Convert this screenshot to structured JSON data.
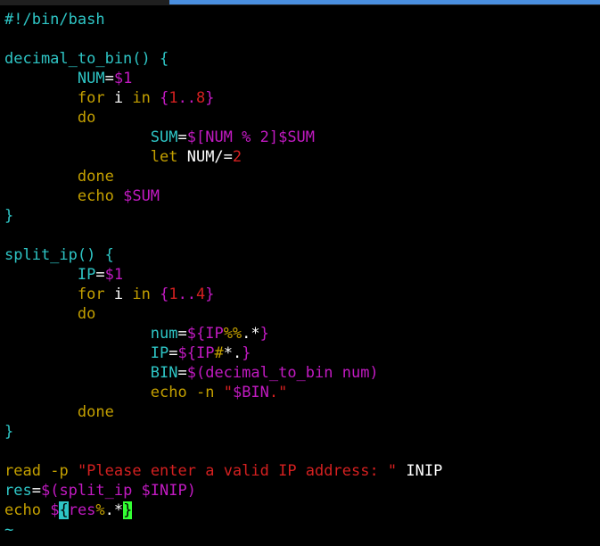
{
  "colors": {
    "background": "#000000",
    "default": "#ffffff",
    "cyan": "#2ec5c5",
    "yellow": "#c4a000",
    "magenta": "#c21ac2",
    "red": "#d42020",
    "green": "#33ff33",
    "cursor": "#2ec5c5"
  },
  "lines": [
    [
      {
        "t": "#!/bin/bash",
        "c": "cyan"
      }
    ],
    [],
    [
      {
        "t": "decimal_to_bin() {",
        "c": "cyan"
      }
    ],
    [
      {
        "t": "        "
      },
      {
        "t": "NUM",
        "c": "cyan"
      },
      {
        "t": "="
      },
      {
        "t": "$1",
        "c": "magenta"
      }
    ],
    [
      {
        "t": "        "
      },
      {
        "t": "for",
        "c": "yellow"
      },
      {
        "t": " i "
      },
      {
        "t": "in",
        "c": "yellow"
      },
      {
        "t": " "
      },
      {
        "t": "{",
        "c": "magenta"
      },
      {
        "t": "1",
        "c": "red"
      },
      {
        "t": "..",
        "c": "magenta"
      },
      {
        "t": "8",
        "c": "red"
      },
      {
        "t": "}",
        "c": "magenta"
      }
    ],
    [
      {
        "t": "        "
      },
      {
        "t": "do",
        "c": "yellow"
      }
    ],
    [
      {
        "t": "                "
      },
      {
        "t": "SUM",
        "c": "cyan"
      },
      {
        "t": "="
      },
      {
        "t": "$[NUM % 2]$SUM",
        "c": "magenta"
      }
    ],
    [
      {
        "t": "                "
      },
      {
        "t": "let",
        "c": "yellow"
      },
      {
        "t": " NUM/="
      },
      {
        "t": "2",
        "c": "red"
      }
    ],
    [
      {
        "t": "        "
      },
      {
        "t": "done",
        "c": "yellow"
      }
    ],
    [
      {
        "t": "        "
      },
      {
        "t": "echo",
        "c": "yellow"
      },
      {
        "t": " "
      },
      {
        "t": "$SUM",
        "c": "magenta"
      }
    ],
    [
      {
        "t": "}",
        "c": "cyan"
      }
    ],
    [],
    [
      {
        "t": "split_ip() {",
        "c": "cyan"
      }
    ],
    [
      {
        "t": "        "
      },
      {
        "t": "IP",
        "c": "cyan"
      },
      {
        "t": "="
      },
      {
        "t": "$1",
        "c": "magenta"
      }
    ],
    [
      {
        "t": "        "
      },
      {
        "t": "for",
        "c": "yellow"
      },
      {
        "t": " i "
      },
      {
        "t": "in",
        "c": "yellow"
      },
      {
        "t": " "
      },
      {
        "t": "{",
        "c": "magenta"
      },
      {
        "t": "1",
        "c": "red"
      },
      {
        "t": "..",
        "c": "magenta"
      },
      {
        "t": "4",
        "c": "red"
      },
      {
        "t": "}",
        "c": "magenta"
      }
    ],
    [
      {
        "t": "        "
      },
      {
        "t": "do",
        "c": "yellow"
      }
    ],
    [
      {
        "t": "                "
      },
      {
        "t": "num",
        "c": "cyan"
      },
      {
        "t": "="
      },
      {
        "t": "${IP",
        "c": "magenta"
      },
      {
        "t": "%%",
        "c": "yellow"
      },
      {
        "t": ".*"
      },
      {
        "t": "}",
        "c": "magenta"
      }
    ],
    [
      {
        "t": "                "
      },
      {
        "t": "IP",
        "c": "cyan"
      },
      {
        "t": "="
      },
      {
        "t": "${IP",
        "c": "magenta"
      },
      {
        "t": "#",
        "c": "yellow"
      },
      {
        "t": "*."
      },
      {
        "t": "}",
        "c": "magenta"
      }
    ],
    [
      {
        "t": "                "
      },
      {
        "t": "BIN",
        "c": "cyan"
      },
      {
        "t": "="
      },
      {
        "t": "$(decimal_to_bin num)",
        "c": "magenta"
      }
    ],
    [
      {
        "t": "                "
      },
      {
        "t": "echo",
        "c": "yellow"
      },
      {
        "t": " "
      },
      {
        "t": "-n",
        "c": "yellow"
      },
      {
        "t": " "
      },
      {
        "t": "\"",
        "c": "red"
      },
      {
        "t": "$BIN",
        "c": "magenta"
      },
      {
        "t": ".\"",
        "c": "red"
      }
    ],
    [
      {
        "t": "        "
      },
      {
        "t": "done",
        "c": "yellow"
      }
    ],
    [
      {
        "t": "}",
        "c": "cyan"
      }
    ],
    [],
    [
      {
        "t": "read",
        "c": "yellow"
      },
      {
        "t": " "
      },
      {
        "t": "-p",
        "c": "yellow"
      },
      {
        "t": " "
      },
      {
        "t": "\"Please enter a valid IP address: \"",
        "c": "red"
      },
      {
        "t": " INIP"
      }
    ],
    [
      {
        "t": "res",
        "c": "cyan"
      },
      {
        "t": "="
      },
      {
        "t": "$(split_ip $INIP)",
        "c": "magenta"
      }
    ],
    [
      {
        "t": "echo",
        "c": "yellow"
      },
      {
        "t": " "
      },
      {
        "t": "$",
        "c": "magenta"
      },
      {
        "t": "{",
        "c": "magenta",
        "hl": "cyan"
      },
      {
        "t": "res",
        "c": "magenta"
      },
      {
        "t": "%",
        "c": "yellow"
      },
      {
        "t": ".*"
      },
      {
        "t": "}",
        "c": "magenta",
        "hl": "green"
      }
    ],
    [
      {
        "t": "~",
        "c": "cyan"
      }
    ]
  ]
}
